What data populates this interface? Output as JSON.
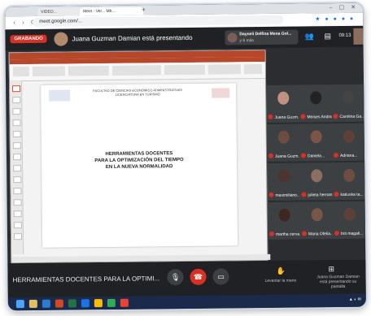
{
  "browser": {
    "tab1": "VIDEO...",
    "tab2": "Meet - Ver... Mb...",
    "url": "meet.google.com/..."
  },
  "meet": {
    "recording": "GRABANDO",
    "presenter_text": "Juana Guzman Damian está presentando",
    "notification_name": "Dayneli Delfina Mena Gol...",
    "notification_sub": "y 6 más",
    "time": "09:13"
  },
  "slide": {
    "faculty": "FACULTAD DE CIENCIAS ECONOMICO ADMINISTRATIVAS LICENCIATURA EN TURISMO",
    "title_lines": [
      "HERRAMIENTAS DOCENTES",
      "PARA LA OPTIMIZACIÓN DEL TIEMPO",
      "EN LA NUEVA NORMALIDAD"
    ]
  },
  "participants": [
    {
      "name": "Juana Guzm..."
    },
    {
      "name": "Moises Andra..."
    },
    {
      "name": "Carolina Ga..."
    },
    {
      "name": "Juana Guzm..."
    },
    {
      "name": "Daniela..."
    },
    {
      "name": "Adriana..."
    },
    {
      "name": "maximiliano..."
    },
    {
      "name": "julieta hernan..."
    },
    {
      "name": "katiuska ta..."
    },
    {
      "name": "martha cerva..."
    },
    {
      "name": "Maria Ofelia..."
    },
    {
      "name": "brit magali..."
    }
  ],
  "bottom": {
    "meeting_title": "HERRAMIENTAS DOCENTES PARA LA OPTIMI...",
    "raise_hand": "Levantar la mano",
    "presenting": "Juana Guzman Damian está presentando su pantalla"
  },
  "colors": {
    "record": "#d93025",
    "end_call": "#d93025",
    "ppt": "#b7472a",
    "meet_bg": "#202124"
  }
}
